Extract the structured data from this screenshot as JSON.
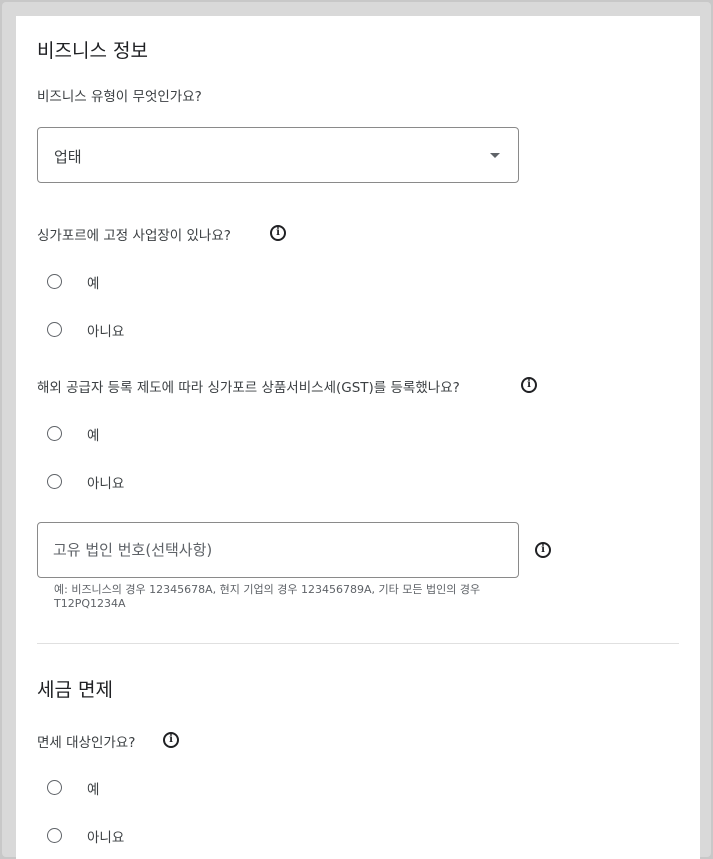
{
  "business_info": {
    "title": "비즈니스 정보",
    "type_question": "비즈니스 유형이 무엇인가요?",
    "type_select": {
      "selected": "업태"
    },
    "fixed_place_question": "싱가포르에 고정 사업장이 있나요?",
    "fixed_place_options": [
      "예",
      "아니요"
    ],
    "gst_question": "해외 공급자 등록 제도에 따라 싱가포르 상품서비스세(GST)를 등록했나요?",
    "gst_options": [
      "예",
      "아니요"
    ],
    "uen_placeholder": "고유 법인 번호(선택사항)",
    "uen_helper": "예: 비즈니스의 경우 12345678A, 현지 기업의 경우 123456789A, 기타 모든 법인의 경우 T12PQ1234A"
  },
  "tax_exemption": {
    "title": "세금 면제",
    "exempt_question": "면세 대상인가요?",
    "exempt_options": [
      "예",
      "아니요"
    ]
  },
  "icons": {
    "info": "info-icon",
    "dropdown": "arrow-drop-down-icon"
  }
}
